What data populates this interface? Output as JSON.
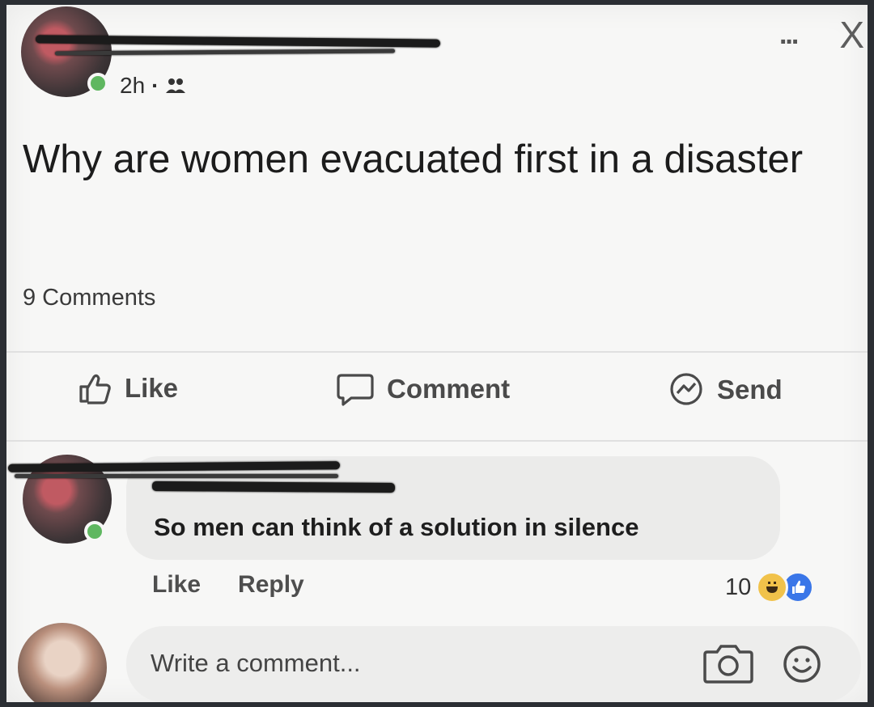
{
  "post": {
    "time": "2h",
    "separator": "·",
    "text": "Why are women evacuated first in a disaster",
    "comment_count": "9 Comments"
  },
  "header": {
    "more_label": "...",
    "close_label": "X"
  },
  "actions": {
    "like": "Like",
    "comment": "Comment",
    "send": "Send"
  },
  "comment": {
    "text": "So men can think of a solution in silence",
    "like": "Like",
    "reply": "Reply",
    "reaction_count": "10"
  },
  "composer": {
    "placeholder": "Write a comment..."
  },
  "colors": {
    "presence": "#5fb760",
    "like_reaction": "#3a76e8",
    "haha_reaction": "#f1c24a"
  },
  "icons": [
    "thumbs-up-icon",
    "comment-icon",
    "messenger-icon",
    "friends-icon",
    "camera-icon",
    "smiley-icon",
    "haha-reaction-icon",
    "like-reaction-icon"
  ]
}
